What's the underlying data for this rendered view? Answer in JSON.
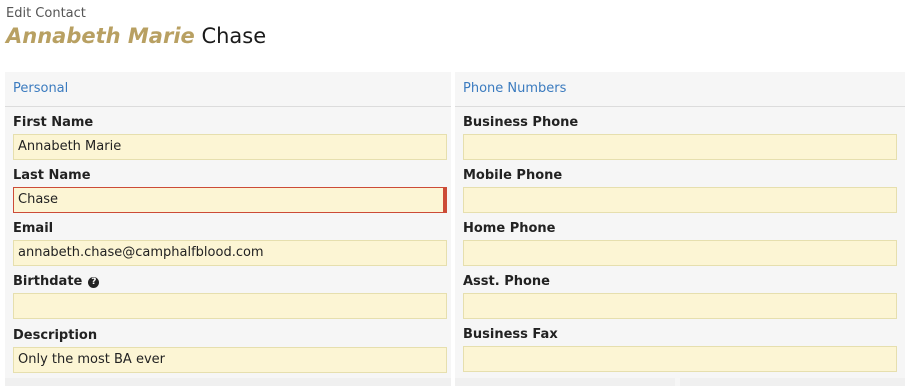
{
  "header": {
    "subtitle": "Edit Contact",
    "given_names": "Annabeth Marie",
    "family_name": "Chase"
  },
  "personal": {
    "title": "Personal",
    "fields": [
      {
        "label": "First Name",
        "value": "Annabeth Marie"
      },
      {
        "label": "Last Name",
        "value": "Chase"
      },
      {
        "label": "Email",
        "value": "annabeth.chase@camphalfblood.com"
      },
      {
        "label": "Birthdate",
        "value": ""
      },
      {
        "label": "Description",
        "value": "Only the most BA ever"
      }
    ]
  },
  "phones": {
    "title": "Phone Numbers",
    "fields": [
      {
        "label": "Business Phone",
        "value": ""
      },
      {
        "label": "Mobile Phone",
        "value": ""
      },
      {
        "label": "Home Phone",
        "value": ""
      },
      {
        "label": "Asst. Phone",
        "value": ""
      },
      {
        "label": "Business Fax",
        "value": ""
      }
    ]
  },
  "icons": {
    "birthdate_help": "question-circle-icon"
  },
  "colors": {
    "accent_name": "#b8a062",
    "section_title": "#3b7bbf",
    "input_bg": "#fcf5d4",
    "error_border": "#cc4b37"
  }
}
